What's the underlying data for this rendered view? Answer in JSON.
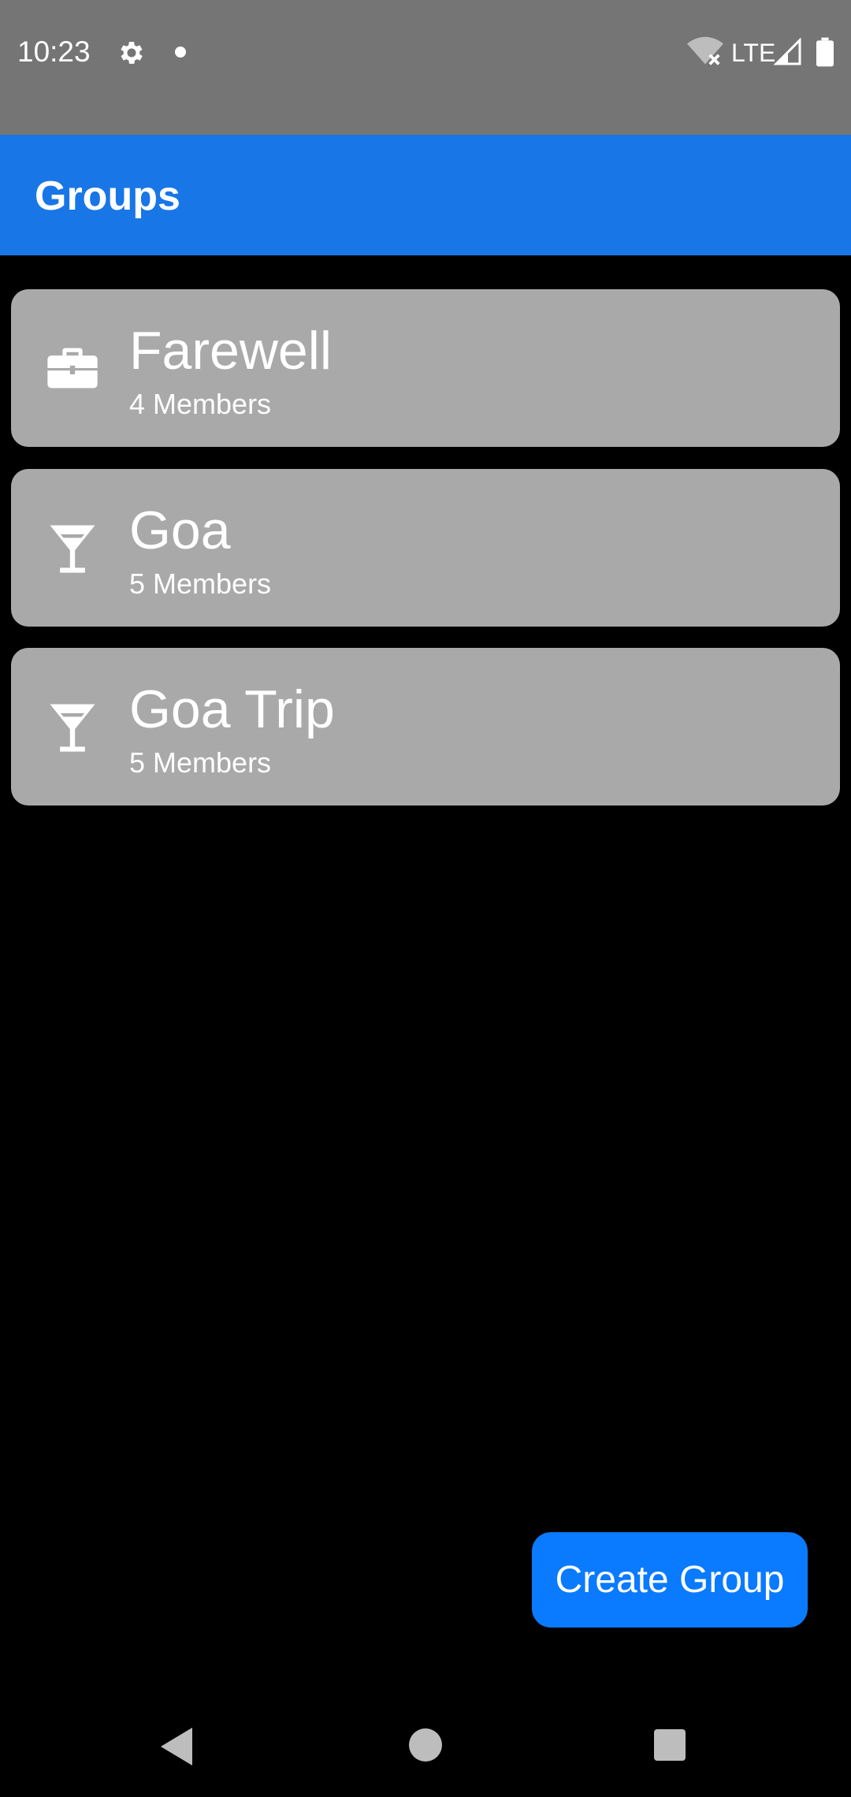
{
  "status_bar": {
    "time": "10:23",
    "network": "LTE",
    "icons": [
      "gear-icon",
      "notification-dot-icon",
      "wifi-off-icon",
      "signal-icon",
      "battery-icon"
    ]
  },
  "app_bar": {
    "title": "Groups",
    "color": "#1976E6"
  },
  "groups": [
    {
      "name": "Farewell",
      "members": "4 Members",
      "icon": "briefcase-icon"
    },
    {
      "name": "Goa",
      "members": "5 Members",
      "icon": "cocktail-icon"
    },
    {
      "name": "Goa Trip",
      "members": "5 Members",
      "icon": "cocktail-icon"
    }
  ],
  "create_button": {
    "label": "Create Group",
    "color": "#0A7AFF"
  },
  "nav_bar": {
    "icons": [
      "back-icon",
      "home-icon",
      "recents-icon"
    ]
  }
}
